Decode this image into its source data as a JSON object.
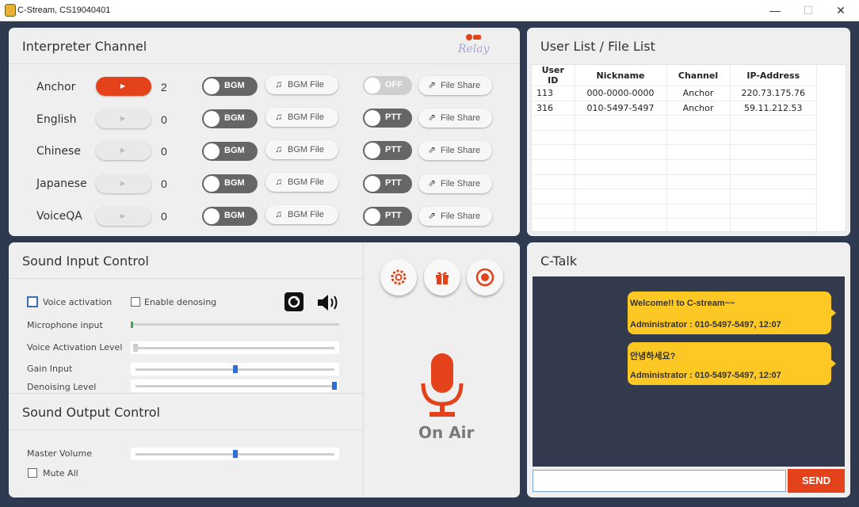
{
  "window": {
    "title": "C-Stream, CS19040401",
    "minimize": "—",
    "maximize": "☐",
    "close": "✕"
  },
  "interpreter": {
    "title": "Interpreter Channel",
    "logo_text": "Relay",
    "bgm_label": "BGM",
    "bgm_file_label": "BGM File",
    "file_share_label": "File Share",
    "channels": [
      {
        "name": "Anchor",
        "count": "2",
        "toggle": "OFF"
      },
      {
        "name": "English",
        "count": "0",
        "toggle": "PTT"
      },
      {
        "name": "Chinese",
        "count": "0",
        "toggle": "PTT"
      },
      {
        "name": "Japanese",
        "count": "0",
        "toggle": "PTT"
      },
      {
        "name": "VoiceQA",
        "count": "0",
        "toggle": "PTT"
      }
    ]
  },
  "userlist": {
    "title": "User List / File List",
    "columns": [
      "User ID",
      "Nickname",
      "Channel",
      "IP-Address"
    ],
    "rows": [
      [
        "113",
        "000-0000-0000",
        "Anchor",
        "220.73.175.76"
      ],
      [
        "316",
        "010-5497-5497",
        "Anchor",
        "59.11.212.53"
      ]
    ]
  },
  "sound_input": {
    "title": "Sound Input Control",
    "voice_activation": "Voice activation",
    "enable_denosing": "Enable denosing",
    "microphone_input": "Microphone input",
    "voice_activation_level": "Voice Activation Level",
    "gain_input": "Gain Input",
    "denoising_level": "Denoising Level",
    "voice_activation_level_value": 0.0,
    "gain_input_value": 0.5,
    "denoising_level_value": 1.0,
    "microphone_level": 0.01
  },
  "sound_output": {
    "title": "Sound Output Control",
    "master_volume": "Master Volume",
    "mute_all": "Mute All",
    "master_volume_value": 0.5
  },
  "onair": {
    "label": "On Air"
  },
  "ctalk": {
    "title": "C-Talk",
    "messages": [
      {
        "text": "Welcome!! to C-stream~~",
        "meta": "Administrator : 010-5497-5497, 12:07"
      },
      {
        "text": "안녕하세요?",
        "meta": "Administrator : 010-5497-5497, 12:07"
      }
    ],
    "input_value": "",
    "send_label": "SEND"
  },
  "colors": {
    "accent": "#e3421a",
    "bubble": "#fdc823",
    "chat_bg": "#333a4d",
    "background": "#2d3a4f"
  }
}
